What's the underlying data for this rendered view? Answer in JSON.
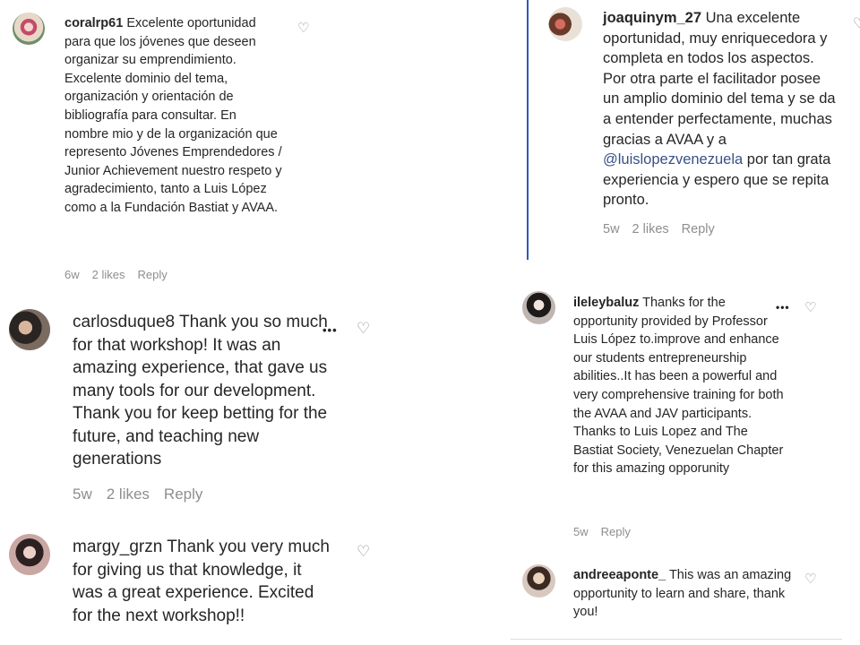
{
  "comments": [
    {
      "username": "coralrp61",
      "text": "Excelente oportunidad para que los jóvenes que deseen organizar su emprendimiento. Excelente dominio del tema, organización y orientación de bibliografía para consultar. En nombre mio y de la organización que represento Jóvenes Emprendedores / Junior Achievement nuestro respeto y agradecimiento, tanto a Luis López como a la Fundación Bastiat y AVAA.",
      "time": "6w",
      "likes": "2 likes",
      "reply": "Reply"
    },
    {
      "username": "joaquinym_27",
      "text_before": "Una excelente oportunidad, muy enriquecedora y completa en todos los aspectos. Por otra parte el facilitador posee un amplio dominio del tema y se da a entender perfectamente, muchas gracias a AVAA y a",
      "mention": "@luislopezvenezuela",
      "text_after": "por tan grata experiencia y espero que se repita pronto.",
      "time": "5w",
      "likes": "2 likes",
      "reply": "Reply"
    },
    {
      "username": "carlosduque8",
      "text": "Thank you so much for that workshop! It was an amazing experience, that gave us many tools for our development. Thank you for keep betting for the future, and teaching new generations",
      "time": "5w",
      "likes": "2 likes",
      "reply": "Reply",
      "more": "•••"
    },
    {
      "username": "ileleybaluz",
      "text": "Thanks for the opportunity provided by Professor Luis López to.improve and enhance our students entrepreneurship abilities..It has been a powerful and very comprehensive training for both the AVAA and JAV participants. Thanks to Luis Lopez and The Bastiat Society, Venezuelan Chapter for this amazing opporunity",
      "time": "5w",
      "reply": "Reply",
      "more": "•••"
    },
    {
      "username": "margy_grzn",
      "text": "Thank you very much for giving us that knowledge, it was a great experience. Excited for the next workshop!!"
    },
    {
      "username": "andreeaponte_",
      "text": "This was an amazing opportunity to learn and share, thank you!"
    }
  ],
  "icons": {
    "heart": "♡",
    "heart_partial": "♡"
  },
  "colors": {
    "mention": "#385185",
    "meta": "#8e8e8e",
    "divider": "#2f5bb5"
  }
}
